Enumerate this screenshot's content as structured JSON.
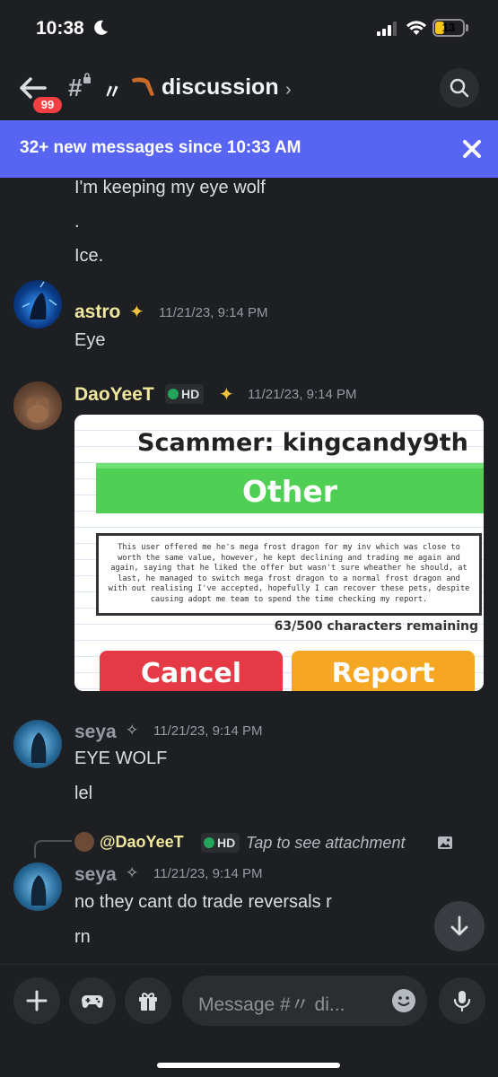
{
  "status_bar": {
    "time": "10:38",
    "battery": "13"
  },
  "header": {
    "unread_badge": "99",
    "channel_prefix": "〃",
    "channel_name": "discussion",
    "chevron": "›"
  },
  "banner": {
    "text": "32+ new messages since 10:33 AM"
  },
  "messages": [
    {
      "kind": "continuation",
      "lines": [
        "I'm keeping my eye wolf",
        ".",
        "Ice."
      ]
    },
    {
      "author": "astro",
      "author_color": "#f0e79e",
      "timestamp": "11/21/23, 9:14 PM",
      "text": "Eye"
    },
    {
      "author": "DaoYeeT",
      "author_color": "#f0e79e",
      "tag": "HD",
      "timestamp": "11/21/23, 9:14 PM",
      "attachment": {
        "title": "Scammer: kingcandy9th",
        "category": "Other",
        "body": "This user offered me he's mega frost dragon for my inv which was close to worth the same value, however, he kept declining and trading me again and again, saying that he liked the offer but wasn't sure wheather he should, at last, he managed to switch mega frost dragon to a normal frost dragon and with out realising I've accepted, hopefully I can recover these pets, despite causing adopt me team to spend the time checking my report.",
        "remaining": "63/500 characters remaining",
        "cancel_label": "Cancel",
        "report_label": "Report"
      }
    },
    {
      "author": "seya",
      "author_color": "#949ba4",
      "timestamp": "11/21/23, 9:14 PM",
      "lines": [
        "EYE WOLF",
        "lel"
      ]
    },
    {
      "reply_to": {
        "author": "@DaoYeeT",
        "tag": "HD",
        "preview": "Tap to see attachment"
      },
      "author": "seya",
      "author_color": "#949ba4",
      "timestamp": "11/21/23, 9:14 PM",
      "lines": [
        "no they cant do trade reversals r",
        "rn"
      ]
    }
  ],
  "composer": {
    "placeholder": "Message #〃 di..."
  },
  "colors": {
    "banner": "#5865f2",
    "background": "#1e1f22",
    "badge": "#f23f43"
  },
  "icons": [
    "moon-icon",
    "signal-icon",
    "wifi-icon",
    "back-arrow-icon",
    "hash-lock-icon",
    "search-icon",
    "close-icon",
    "sparkle-icon",
    "arrow-down-icon",
    "plus-icon",
    "gamepad-icon",
    "gift-icon",
    "emoji-icon",
    "mic-icon"
  ]
}
